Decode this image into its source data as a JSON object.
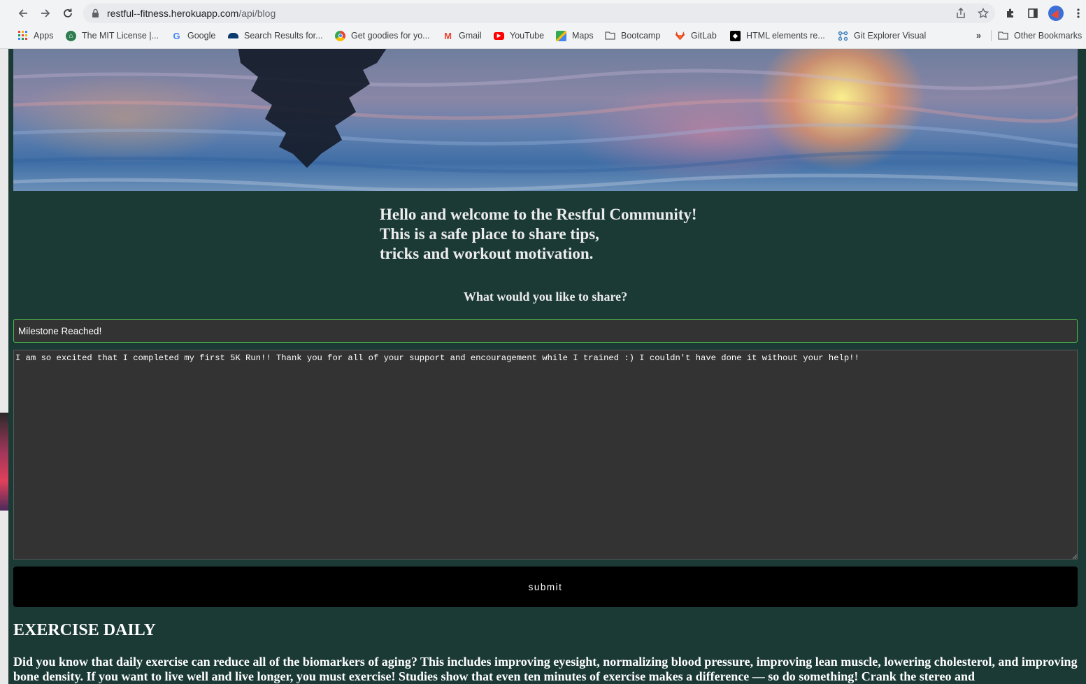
{
  "browser": {
    "url_host": "restful--fitness.herokuapp.com",
    "url_path": "/api/blog",
    "bookmarks": [
      {
        "label": "Apps",
        "icon": "apps-grid-icon"
      },
      {
        "label": "The MIT License |...",
        "icon": "mit-license-favicon-icon"
      },
      {
        "label": "Google",
        "icon": "google-favicon-icon"
      },
      {
        "label": "Search Results for...",
        "icon": "search-results-favicon-icon"
      },
      {
        "label": "Get goodies for yo...",
        "icon": "chrome-favicon-icon"
      },
      {
        "label": "Gmail",
        "icon": "gmail-favicon-icon"
      },
      {
        "label": "YouTube",
        "icon": "youtube-favicon-icon"
      },
      {
        "label": "Maps",
        "icon": "maps-favicon-icon"
      },
      {
        "label": "Bootcamp",
        "icon": "folder-icon"
      },
      {
        "label": "GitLab",
        "icon": "gitlab-favicon-icon"
      },
      {
        "label": "HTML elements re...",
        "icon": "html-elements-favicon-icon"
      },
      {
        "label": "Git Explorer Visual",
        "icon": "git-explorer-favicon-icon"
      }
    ],
    "overflow_label": "»",
    "other_bookmarks": "Other Bookmarks"
  },
  "page": {
    "welcome_lines": [
      "Hello and welcome to the Restful Community!",
      "This is a safe place to share tips,",
      "tricks and workout motivation."
    ],
    "share_question": "What would you like to share?",
    "form": {
      "title_value": "Milestone Reached!",
      "body_value": "I am so excited that I completed my first 5K Run!! Thank you for all of your support and encouragement while I trained :) I couldn't have done it without your help!!",
      "submit_label": "submit"
    },
    "post": {
      "title": "EXERCISE DAILY",
      "body": "Did you know that daily exercise can reduce all of the biomarkers of aging? This includes improving eyesight, normalizing blood pressure, improving lean muscle, lowering cholesterol, and improving bone density. If you want to live well and live longer, you must exercise! Studies show that even ten minutes of exercise makes a difference — so do something! Crank the stereo and"
    }
  },
  "colors": {
    "page_background": "#1b3a36",
    "input_background": "#333333",
    "input_focus_border": "#4cba4c",
    "submit_background": "#000000"
  }
}
